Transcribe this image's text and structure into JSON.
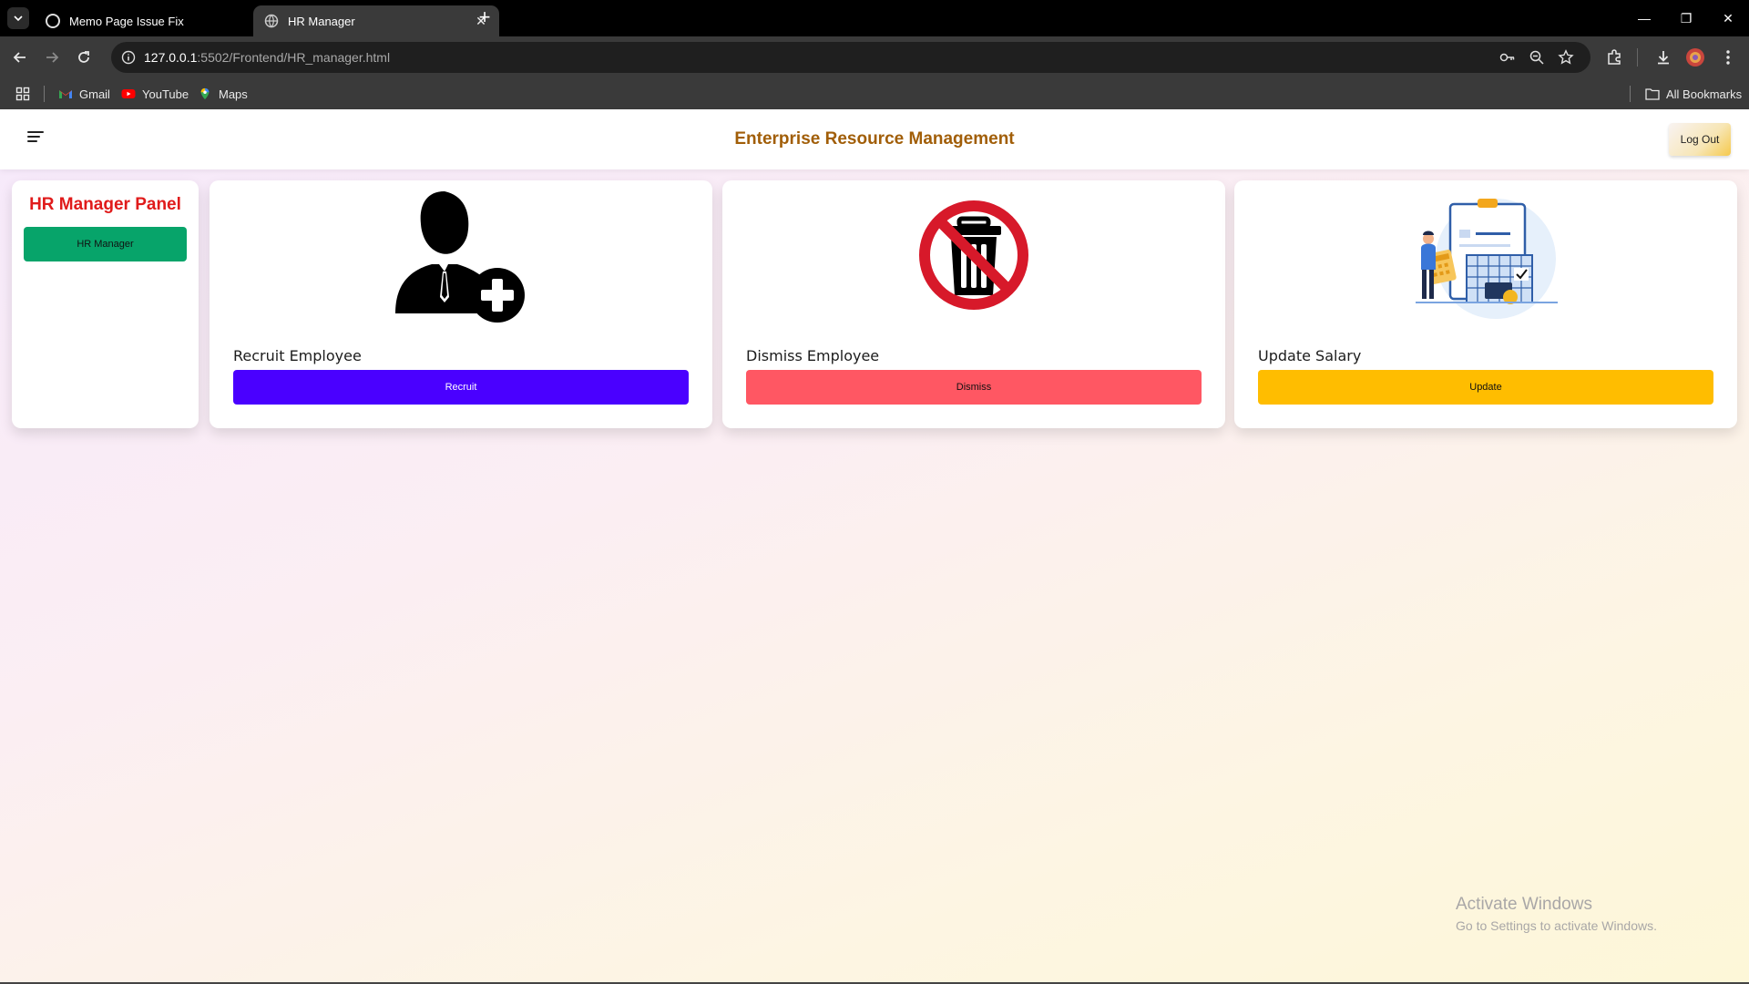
{
  "browser": {
    "tabs": [
      {
        "title": "Memo Page Issue Fix",
        "active": false
      },
      {
        "title": "HR Manager",
        "active": true
      }
    ],
    "url_host": "127.0.0.1",
    "url_path": ":5502/Frontend/HR_manager.html",
    "bookmarks": [
      "Gmail",
      "YouTube",
      "Maps"
    ],
    "all_bookmarks": "All Bookmarks"
  },
  "header": {
    "title": "Enterprise Resource Management",
    "logout_label": "Log Out"
  },
  "sidebar": {
    "title": "HR Manager Panel",
    "button_label": "HR Manager"
  },
  "cards": [
    {
      "label": "Recruit Employee",
      "button": "Recruit",
      "icon": "add-employee-icon",
      "color": "#4a00ff"
    },
    {
      "label": "Dismiss Employee",
      "button": "Dismiss",
      "icon": "no-trash-icon",
      "color": "#ff5763"
    },
    {
      "label": "Update Salary",
      "button": "Update",
      "icon": "salary-illustration-icon",
      "color": "#ffbd00"
    }
  ],
  "watermark": {
    "line1": "Activate Windows",
    "line2": "Go to Settings to activate Windows."
  },
  "colors": {
    "title": "#a15e08",
    "panel_title": "#e01b1b",
    "hr_button": "#07a46a"
  }
}
